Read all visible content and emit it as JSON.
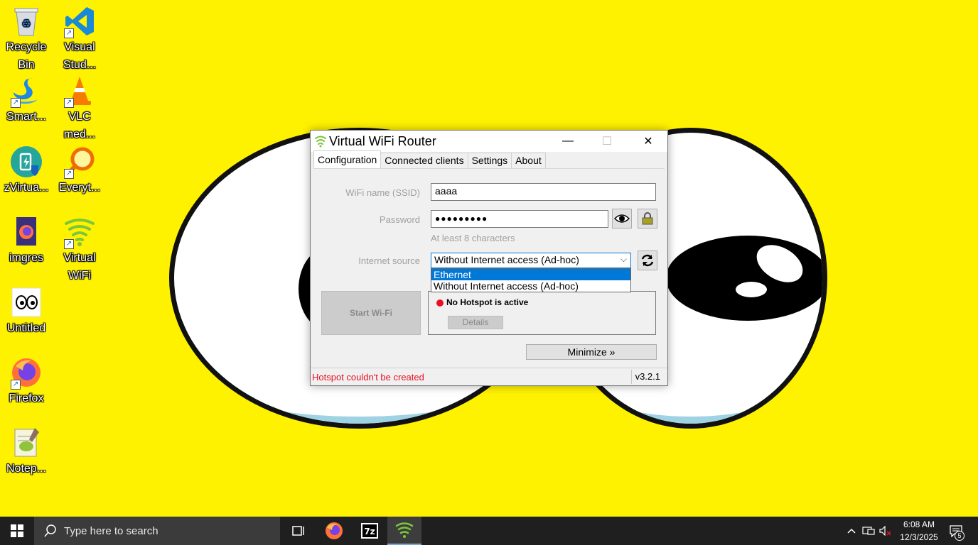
{
  "desktop": {
    "icons": [
      {
        "label": "Recycle Bin",
        "icon": "recycle-bin-icon"
      },
      {
        "label": "Visual Stud...",
        "icon": "vscode-icon"
      },
      {
        "label": "Smart...",
        "icon": "swan-icon"
      },
      {
        "label": "VLC med...",
        "icon": "vlc-cone-icon"
      },
      {
        "label": "zVirtua...",
        "icon": "zvirtual-icon"
      },
      {
        "label": "Everyt...",
        "icon": "everything-search-icon"
      },
      {
        "label": "imgres",
        "icon": "firefox-file-icon"
      },
      {
        "label": "Virtual WiFi",
        "icon": "wifi-router-icon"
      },
      {
        "label": "Untitled",
        "icon": "eyes-image-icon"
      },
      {
        "label": "Firefox",
        "icon": "firefox-icon"
      },
      {
        "label": "Notep...",
        "icon": "notepad-plus-icon"
      }
    ]
  },
  "window": {
    "title": "Virtual WiFi Router",
    "controls": {
      "minimize": "—",
      "maximize": "☐",
      "close": "✕"
    },
    "tabs": [
      "Configuration",
      "Connected clients",
      "Settings",
      "About"
    ],
    "active_tab": "Configuration",
    "form": {
      "ssid_label": "WiFi name (SSID)",
      "ssid_value": "aaaa",
      "password_label": "Password",
      "password_value": "●●●●●●●●●",
      "password_hint": "At least 8 characters",
      "source_label": "Internet source",
      "source_selected": "Without Internet access (Ad-hoc)",
      "source_options": [
        "Ethernet",
        "Without Internet access (Ad-hoc)"
      ],
      "highlighted_option": "Ethernet"
    },
    "start_button": "Start Wi-Fi",
    "status": {
      "text": "No Hotspot is active",
      "details_button": "Details",
      "color": "#e81123"
    },
    "minimize_button": "Minimize »",
    "statusbar": {
      "message": "Hotspot couldn't be created",
      "version": "v3.2.1"
    }
  },
  "taskbar": {
    "search_placeholder": "Type here to search",
    "apps": [
      "task-view-icon",
      "firefox-icon",
      "7zip-icon",
      "wifi-router-icon"
    ],
    "clock": {
      "time": "6:08 AM",
      "date": "12/3/2025"
    },
    "notification_count": "5"
  },
  "colors": {
    "wallpaper": "#fff200",
    "accent": "#0078d7",
    "error": "#e81123"
  }
}
